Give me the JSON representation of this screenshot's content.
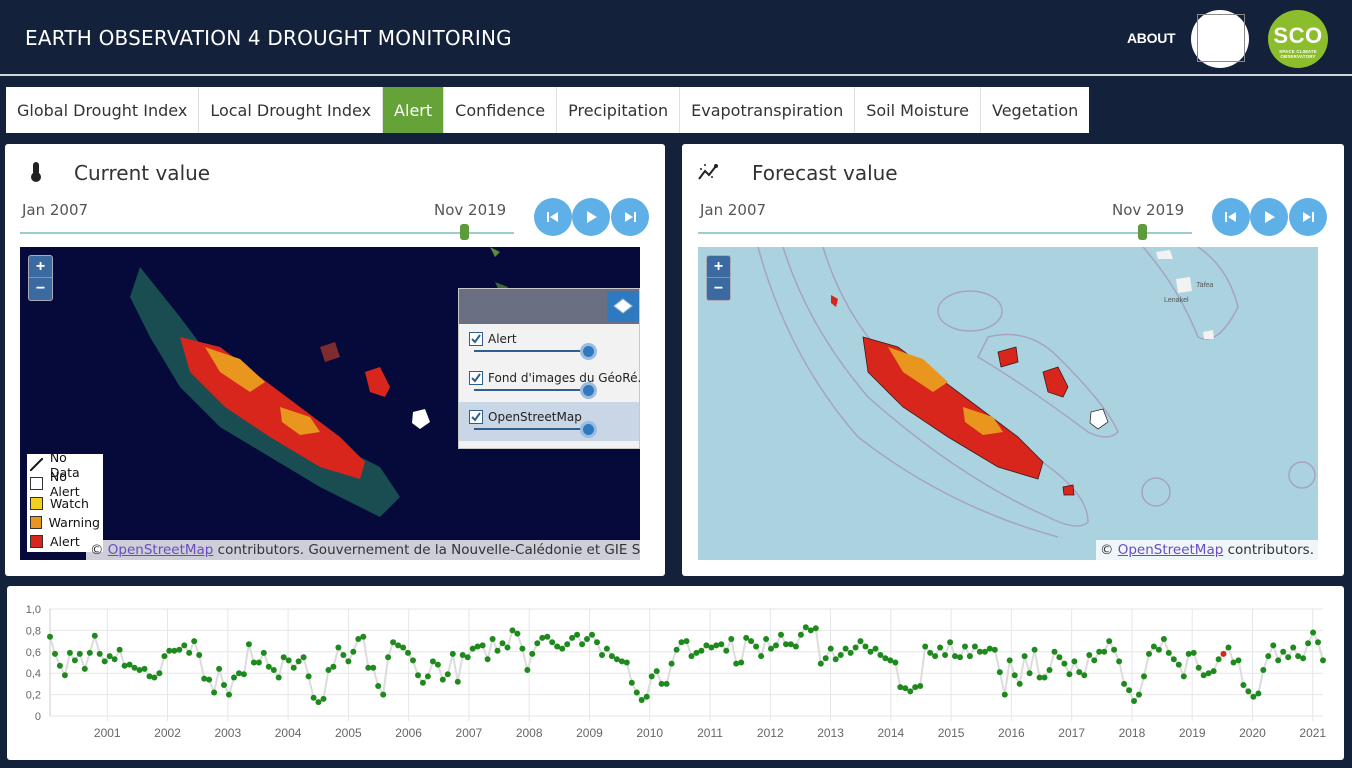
{
  "header": {
    "title": "EARTH OBSERVATION 4 DROUGHT MONITORING",
    "about_label": "ABOUT",
    "sco_logo_text": "SCO",
    "sco_logo_subtext": "SPACE CLIMATE OBSERVATORY"
  },
  "tabs": [
    {
      "label": "Global Drought Index",
      "active": false
    },
    {
      "label": "Local Drought Index",
      "active": false
    },
    {
      "label": "Alert",
      "active": true
    },
    {
      "label": "Confidence",
      "active": false
    },
    {
      "label": "Precipitation",
      "active": false
    },
    {
      "label": "Evapotranspiration",
      "active": false
    },
    {
      "label": "Soil Moisture",
      "active": false
    },
    {
      "label": "Vegetation",
      "active": false
    }
  ],
  "current_panel": {
    "title": "Current value",
    "icon": "thermometer-icon",
    "date_start": "Jan 2007",
    "date_end": "Nov 2019",
    "slider_position": 0.9,
    "attribution_link": "OpenStreetMap",
    "attribution_text": " contributors. Gouvernement de la Nouvelle-Calédonie et GIE SERAIL",
    "layers": [
      {
        "label": "Alert",
        "checked": true
      },
      {
        "label": "Fond d'images du GéoRé...",
        "checked": true
      },
      {
        "label": "OpenStreetMap",
        "checked": true
      }
    ],
    "legend": [
      {
        "label": "No Data",
        "color": "none"
      },
      {
        "label": "No Alert",
        "color": "#ffffff"
      },
      {
        "label": "Watch",
        "color": "#f2d11b"
      },
      {
        "label": "Warning",
        "color": "#e8961e"
      },
      {
        "label": "Alert",
        "color": "#d9261c"
      }
    ]
  },
  "forecast_panel": {
    "title": "Forecast value",
    "icon": "chart-trend-icon",
    "date_start": "Jan 2007",
    "date_end": "Nov 2019",
    "slider_position": 0.9,
    "attribution_prefix": "© ",
    "attribution_link": "OpenStreetMap",
    "attribution_text": " contributors.",
    "place_labels": [
      "Lenakel",
      "Tafea"
    ]
  },
  "colors": {
    "header_bg": "#13213b",
    "tab_active": "#65a338",
    "button_blue": "#5fb0e6",
    "point_normal": "#1e8a1e",
    "point_alert": "#d9261c"
  },
  "chart_data": {
    "type": "scatter",
    "ylim": [
      0,
      1.0
    ],
    "yticks": [
      "1,0",
      "0,8",
      "0,6",
      "0,4",
      "0,2",
      "0"
    ],
    "xticks": [
      "2001",
      "2002",
      "2003",
      "2004",
      "2005",
      "2006",
      "2007",
      "2008",
      "2009",
      "2010",
      "2011",
      "2012",
      "2013",
      "2014",
      "2015",
      "2016",
      "2017",
      "2018",
      "2019",
      "2020",
      "2021"
    ],
    "x_start": 2000.05,
    "x_end": 2021.17,
    "alert_index": 236,
    "values": [
      0.74,
      0.58,
      0.47,
      0.38,
      0.59,
      0.52,
      0.58,
      0.44,
      0.59,
      0.75,
      0.58,
      0.51,
      0.56,
      0.53,
      0.62,
      0.47,
      0.48,
      0.45,
      0.43,
      0.44,
      0.37,
      0.36,
      0.4,
      0.56,
      0.61,
      0.61,
      0.62,
      0.66,
      0.59,
      0.7,
      0.57,
      0.35,
      0.34,
      0.22,
      0.44,
      0.29,
      0.2,
      0.36,
      0.4,
      0.39,
      0.67,
      0.5,
      0.5,
      0.59,
      0.46,
      0.43,
      0.36,
      0.55,
      0.52,
      0.45,
      0.51,
      0.55,
      0.37,
      0.17,
      0.13,
      0.16,
      0.43,
      0.46,
      0.64,
      0.57,
      0.51,
      0.6,
      0.72,
      0.74,
      0.45,
      0.45,
      0.28,
      0.2,
      0.55,
      0.69,
      0.66,
      0.64,
      0.59,
      0.52,
      0.38,
      0.31,
      0.37,
      0.51,
      0.48,
      0.34,
      0.39,
      0.58,
      0.32,
      0.57,
      0.55,
      0.63,
      0.65,
      0.66,
      0.53,
      0.72,
      0.61,
      0.68,
      0.64,
      0.8,
      0.77,
      0.63,
      0.43,
      0.58,
      0.68,
      0.73,
      0.74,
      0.69,
      0.65,
      0.63,
      0.67,
      0.73,
      0.76,
      0.67,
      0.72,
      0.76,
      0.69,
      0.57,
      0.63,
      0.56,
      0.53,
      0.51,
      0.5,
      0.31,
      0.22,
      0.15,
      0.18,
      0.37,
      0.42,
      0.3,
      0.3,
      0.49,
      0.62,
      0.69,
      0.7,
      0.56,
      0.59,
      0.61,
      0.66,
      0.64,
      0.66,
      0.67,
      0.61,
      0.72,
      0.49,
      0.5,
      0.73,
      0.7,
      0.65,
      0.56,
      0.72,
      0.63,
      0.66,
      0.76,
      0.67,
      0.67,
      0.65,
      0.76,
      0.83,
      0.8,
      0.82,
      0.49,
      0.54,
      0.63,
      0.53,
      0.57,
      0.63,
      0.59,
      0.64,
      0.7,
      0.65,
      0.6,
      0.63,
      0.57,
      0.54,
      0.52,
      0.5,
      0.27,
      0.26,
      0.23,
      0.27,
      0.28,
      0.65,
      0.59,
      0.56,
      0.64,
      0.57,
      0.69,
      0.56,
      0.55,
      0.65,
      0.56,
      0.65,
      0.6,
      0.6,
      0.63,
      0.62,
      0.41,
      0.2,
      0.52,
      0.38,
      0.3,
      0.56,
      0.4,
      0.62,
      0.36,
      0.36,
      0.43,
      0.6,
      0.55,
      0.49,
      0.39,
      0.51,
      0.41,
      0.38,
      0.57,
      0.52,
      0.6,
      0.6,
      0.7,
      0.62,
      0.51,
      0.3,
      0.24,
      0.14,
      0.2,
      0.37,
      0.58,
      0.65,
      0.62,
      0.72,
      0.59,
      0.53,
      0.48,
      0.37,
      0.58,
      0.59,
      0.45,
      0.38,
      0.4,
      0.42,
      0.53,
      0.58,
      0.64,
      0.5,
      0.52,
      0.29,
      0.23,
      0.18,
      0.21,
      0.43,
      0.56,
      0.66,
      0.52,
      0.6,
      0.55,
      0.64,
      0.56,
      0.54,
      0.68,
      0.78,
      0.69,
      0.52
    ]
  }
}
